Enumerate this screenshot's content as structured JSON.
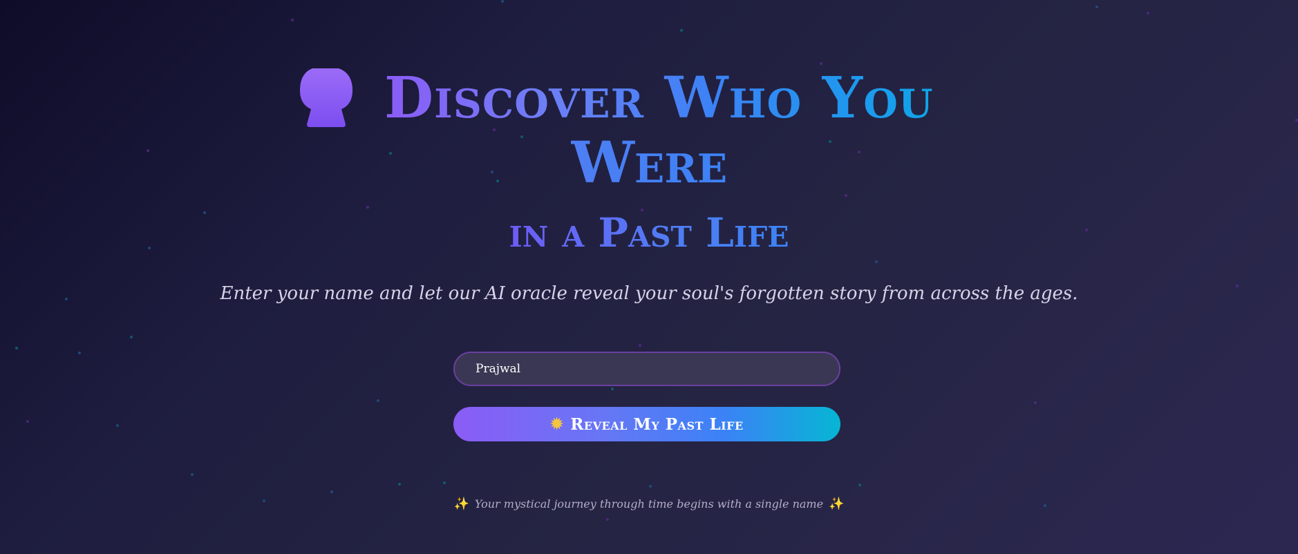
{
  "header": {
    "title_line1": "Discover Who You",
    "title_line2": "Were",
    "subtitle": "in a Past Life",
    "icon": "crystal-ball-icon"
  },
  "intro": {
    "tagline": "Enter your name and let our AI oracle reveal your soul's forgotten story from across the ages."
  },
  "form": {
    "name_value": "Prajwal",
    "submit_label": "Reveal My Past Life",
    "submit_icon": "sun-icon"
  },
  "footer": {
    "note": "Your mystical journey through time begins with a single name",
    "icon": "sparkles-icon"
  },
  "colors": {
    "background_start": "#0f0c29",
    "background_end": "#2c2751",
    "accent_purple": "#8b5cf6",
    "accent_blue": "#3b82f6",
    "accent_cyan": "#06b6d4"
  }
}
